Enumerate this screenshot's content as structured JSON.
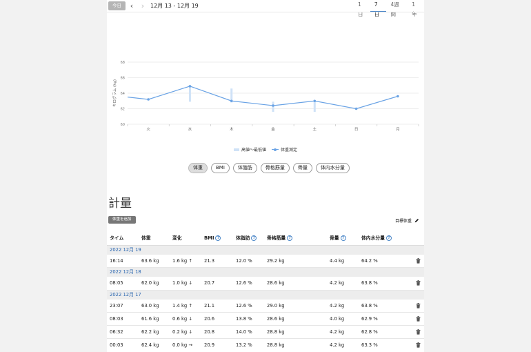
{
  "toolbar": {
    "today_label": "今日",
    "prev_icon": "chevron-left-icon",
    "next_icon": "chevron-right-icon",
    "date_range": "12月 13 - 12月 19",
    "range_tabs": [
      {
        "label": "1日",
        "active": false
      },
      {
        "label": "7日",
        "active": true
      },
      {
        "label": "4週間",
        "active": false
      },
      {
        "label": "1年",
        "active": false
      }
    ]
  },
  "chart_data": {
    "type": "line",
    "ylabel": "キログラム (kg)",
    "ylim": [
      60,
      68
    ],
    "yticks": [
      60,
      62,
      64,
      66,
      68
    ],
    "categories": [
      "火",
      "水",
      "木",
      "金",
      "土",
      "日",
      "月"
    ],
    "grid": true,
    "legend_position": "bottom",
    "series": [
      {
        "name": "体重測定",
        "color": "#6aa3e5",
        "x": [
          -0.5,
          0,
          1,
          2,
          3,
          4,
          5,
          6
        ],
        "values": [
          63.5,
          63.2,
          64.9,
          63.0,
          62.4,
          63.0,
          62.0,
          63.6
        ]
      },
      {
        "name": "高値〜最低値",
        "color": "#cfe2f7",
        "x": [
          1,
          2,
          3,
          4
        ],
        "ranges": [
          [
            62.9,
            64.9
          ],
          [
            62.8,
            64.6
          ],
          [
            61.6,
            62.9
          ],
          [
            61.6,
            63.0
          ]
        ]
      }
    ]
  },
  "legend": {
    "range_label": "高値〜最低値",
    "line_label": "体重測定"
  },
  "metrics": [
    {
      "label": "体重",
      "active": true
    },
    {
      "label": "BMI",
      "active": false
    },
    {
      "label": "体脂肪",
      "active": false
    },
    {
      "label": "骨格筋量",
      "active": false
    },
    {
      "label": "骨量",
      "active": false
    },
    {
      "label": "体内水分量",
      "active": false
    }
  ],
  "section_title": "計量",
  "add_button_label": "体重を追加",
  "target_label": "目標体重",
  "table": {
    "headers": {
      "time": "タイム",
      "weight": "体重",
      "change": "変化",
      "bmi": "BMI",
      "fat": "体脂肪",
      "muscle": "骨格筋量",
      "bone": "骨量",
      "water": "体内水分量"
    },
    "groups": [
      {
        "date": "2022 12月 19",
        "rows": [
          {
            "time": "16:14",
            "weight": "63.6 kg",
            "change": "1.6 kg ↑",
            "bmi": "21.3",
            "fat": "12.0 %",
            "muscle": "29.2 kg",
            "bone": "4.4 kg",
            "water": "64.2 %"
          }
        ]
      },
      {
        "date": "2022 12月 18",
        "rows": [
          {
            "time": "08:05",
            "weight": "62.0 kg",
            "change": "1.0 kg ↓",
            "bmi": "20.7",
            "fat": "12.6 %",
            "muscle": "28.6 kg",
            "bone": "4.2 kg",
            "water": "63.8 %"
          }
        ]
      },
      {
        "date": "2022 12月 17",
        "rows": [
          {
            "time": "23:07",
            "weight": "63.0 kg",
            "change": "1.4 kg ↑",
            "bmi": "21.1",
            "fat": "12.6 %",
            "muscle": "29.0 kg",
            "bone": "4.2 kg",
            "water": "63.8 %"
          },
          {
            "time": "08:03",
            "weight": "61.6 kg",
            "change": "0.6 kg ↓",
            "bmi": "20.6",
            "fat": "13.8 %",
            "muscle": "28.6 kg",
            "bone": "4.0 kg",
            "water": "62.9 %"
          },
          {
            "time": "06:32",
            "weight": "62.2 kg",
            "change": "0.2 kg ↓",
            "bmi": "20.8",
            "fat": "14.0 %",
            "muscle": "28.8 kg",
            "bone": "4.2 kg",
            "water": "62.8 %"
          },
          {
            "time": "00:03",
            "weight": "62.4 kg",
            "change": "0.0 kg →",
            "bmi": "20.9",
            "fat": "13.2 %",
            "muscle": "28.8 kg",
            "bone": "4.2 kg",
            "water": "63.3 %"
          }
        ]
      }
    ]
  }
}
